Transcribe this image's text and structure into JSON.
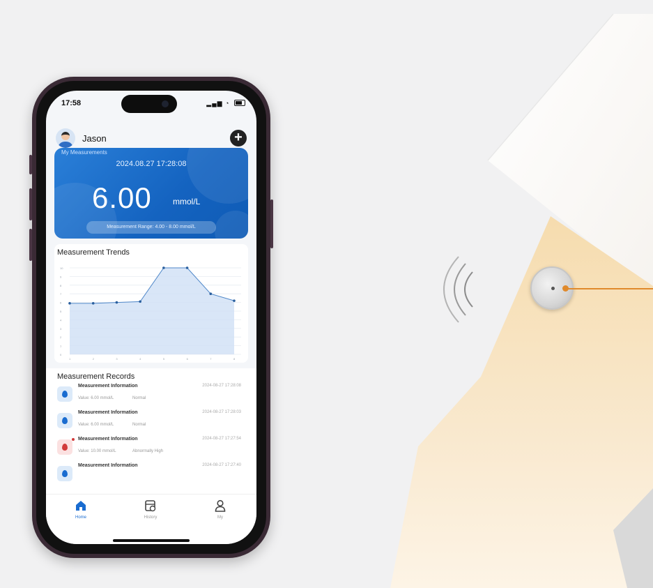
{
  "status_bar": {
    "time": "17:58"
  },
  "user": {
    "name": "Jason",
    "add_button": "+"
  },
  "measurement": {
    "title": "My Measurements",
    "datetime": "2024.08.27  17:28:08",
    "value": "6.00",
    "unit": "mmol/L",
    "range": "Measurement Range: 4.00 - 8.00 mmol/L"
  },
  "trends": {
    "title": "Measurement Trends"
  },
  "chart_data": {
    "type": "area",
    "title": "Measurement Trends",
    "x": [
      1,
      2,
      3,
      4,
      5,
      6,
      7,
      8
    ],
    "values": [
      5.9,
      5.9,
      6.0,
      6.1,
      10.0,
      10.0,
      7.0,
      6.2
    ],
    "ylim": [
      0,
      10
    ],
    "yticks": [
      "0",
      "1",
      "2",
      "3",
      "4",
      "5",
      "6",
      "7",
      "8",
      "9",
      "10"
    ],
    "grid": true
  },
  "records": {
    "title": "Measurement Records",
    "items": [
      {
        "name": "Measurement Information",
        "time": "2024-08-27 17:28:08",
        "value": "Value: 6.00 mmol/L",
        "status": "Normal",
        "level": "normal"
      },
      {
        "name": "Measurement Information",
        "time": "2024-08-27 17:28:03",
        "value": "Value: 6.00 mmol/L",
        "status": "Normal",
        "level": "normal"
      },
      {
        "name": "Measurement Information",
        "time": "2024-08-27 17:27:54",
        "value": "Value: 10.00 mmol/L",
        "status": "Abnormally High",
        "level": "high"
      },
      {
        "name": "Measurement Information",
        "time": "2024-08-27 17:27:40",
        "value": "",
        "status": "",
        "level": "normal"
      }
    ]
  },
  "tabs": [
    {
      "label": "Home",
      "icon": "home-icon",
      "active": true
    },
    {
      "label": "History",
      "icon": "history-icon",
      "active": false
    },
    {
      "label": "My",
      "icon": "user-icon",
      "active": false
    }
  ],
  "colors": {
    "accent": "#1463c0",
    "sensor_leader": "#e08a2c",
    "abnormal": "#d23b3b"
  }
}
